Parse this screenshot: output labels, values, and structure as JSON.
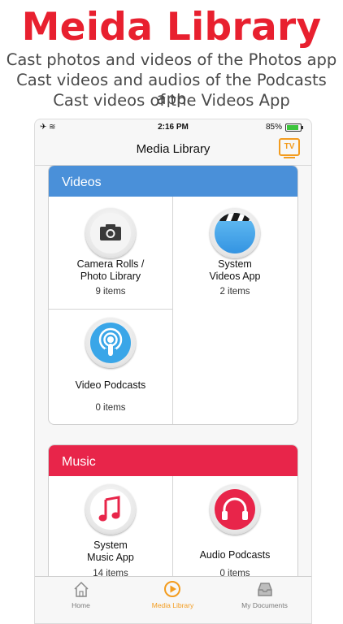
{
  "promo": {
    "headline": "Meida Library",
    "lines": [
      "Cast photos and videos of the Photos app",
      "Cast videos and audios of the Podcasts app",
      "Cast videos of the Videos App"
    ]
  },
  "status_bar": {
    "time": "2:16 PM",
    "battery_percent": "85%",
    "battery_level": 0.85
  },
  "nav": {
    "title": "Media Library",
    "tv_button_label": "TV"
  },
  "sections": [
    {
      "title": "Videos",
      "color": "#4a90d9",
      "items": [
        {
          "label_line1": "Camera Rolls /",
          "label_line2": "Photo Library",
          "count": "9 items",
          "icon": "camera-icon"
        },
        {
          "label_line1": "System",
          "label_line2": "Videos App",
          "count": "2 items",
          "icon": "clapperboard-icon"
        },
        {
          "label_line1": "Video Podcasts",
          "label_line2": "",
          "count": "0 items",
          "icon": "podcast-icon"
        }
      ]
    },
    {
      "title": "Music",
      "color": "#e8254a",
      "items": [
        {
          "label_line1": "System",
          "label_line2": "Music App",
          "count": "14 items",
          "icon": "music-note-icon"
        },
        {
          "label_line1": "Audio Podcasts",
          "label_line2": "",
          "count": "0 items",
          "icon": "headphones-icon"
        }
      ]
    }
  ],
  "tabs": [
    {
      "label": "Home",
      "icon": "house-icon"
    },
    {
      "label": "Media Library",
      "icon": "play-circle-icon",
      "active": true
    },
    {
      "label": "My Documents",
      "icon": "inbox-tray-icon"
    }
  ],
  "colors": {
    "accent": "#f39c1f",
    "headline": "#e8202f"
  }
}
